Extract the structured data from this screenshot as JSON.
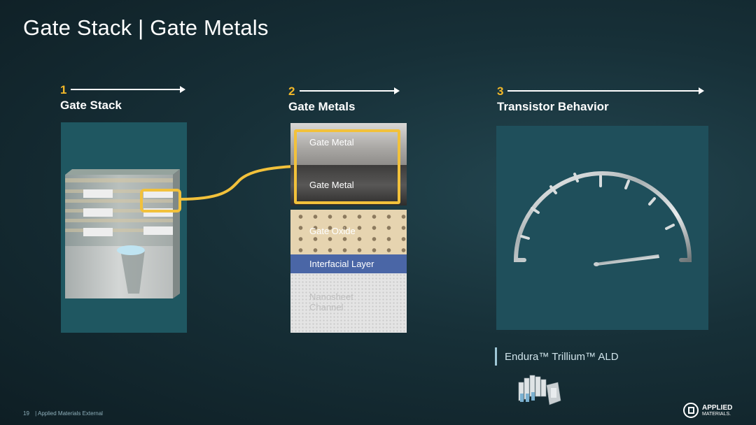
{
  "title": "Gate Stack | Gate Metals",
  "steps": [
    {
      "number": "1",
      "label": "Gate Stack"
    },
    {
      "number": "2",
      "label": "Gate Metals"
    },
    {
      "number": "3",
      "label": "Transistor Behavior"
    }
  ],
  "gate_metals": {
    "layers": [
      {
        "label": "Gate Metal"
      },
      {
        "label": "Gate Metal"
      },
      {
        "label": "Gate Oxide"
      },
      {
        "label": "Interfacial Layer"
      },
      {
        "label": "Nanosheet\nChannel"
      }
    ]
  },
  "product": "Endura™ Trillium™ ALD",
  "footer": {
    "page_number": "19",
    "text": "| Applied Materials External"
  },
  "logo": {
    "line1": "APPLIED",
    "line2": "MATERIALS."
  },
  "colors": {
    "accent": "#f2b829",
    "panel": "#1f5761",
    "background": "#173038"
  }
}
